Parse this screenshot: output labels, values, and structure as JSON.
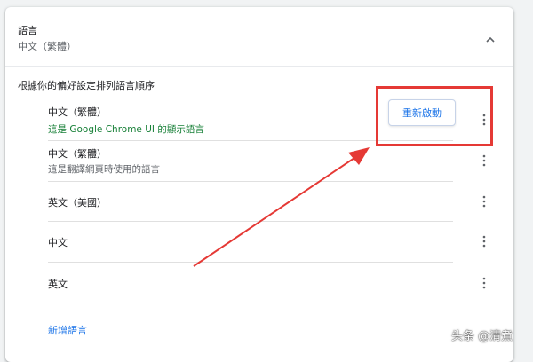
{
  "section": {
    "title": "語言",
    "current": "中文（繁體）",
    "order_label": "根據你的偏好設定排列語言順序"
  },
  "languages": [
    {
      "name": "中文（繁體）",
      "desc": "這是 Google Chrome UI 的顯示語言"
    },
    {
      "name": "中文（繁體）",
      "desc": "這是翻譯網頁時使用的語言"
    },
    {
      "name": "英文（美國）",
      "desc": ""
    },
    {
      "name": "中文",
      "desc": ""
    },
    {
      "name": "英文",
      "desc": ""
    }
  ],
  "restart_button": "重新啟動",
  "add_language": "新增語言",
  "watermark": "头条 @清煮",
  "colors": {
    "accent": "#1a73e8",
    "green": "#188038",
    "annotation_red": "#e53935"
  },
  "icons": {
    "collapse": "chevron-up-icon",
    "more": "more-vert-icon"
  }
}
